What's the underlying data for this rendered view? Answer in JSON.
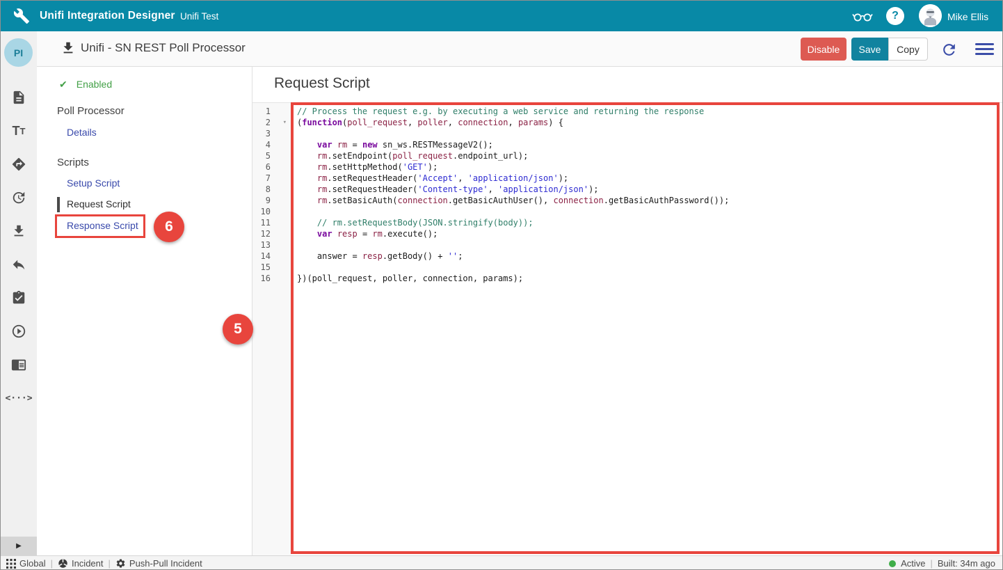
{
  "header": {
    "app_title": "Unifi Integration Designer",
    "workspace": "Unifi Test",
    "user_name": "Mike Ellis"
  },
  "toolbar": {
    "avatar_initials": "PI",
    "title": "Unifi - SN REST Poll Processor",
    "disable_label": "Disable",
    "save_label": "Save",
    "copy_label": "Copy"
  },
  "sidebar": {
    "icons": [
      "document",
      "text-format",
      "directions",
      "history",
      "download",
      "undo",
      "tasks",
      "run",
      "documentation",
      "code"
    ]
  },
  "nav": {
    "enabled_label": "Enabled",
    "enabled_check": "✔",
    "poll_processor_title": "Poll Processor",
    "details_label": "Details",
    "scripts_title": "Scripts",
    "setup_script_label": "Setup Script",
    "request_script_label": "Request Script",
    "response_script_label": "Response Script"
  },
  "annotations": {
    "step_5": "5",
    "step_6": "6"
  },
  "editor": {
    "heading": "Request Script",
    "fold_marker": "▾",
    "fold_line": 2,
    "lines": [
      [
        {
          "c": "c",
          "t": "// Process the request e.g. by executing a web service and returning the response"
        }
      ],
      [
        {
          "c": "p",
          "t": "("
        },
        {
          "c": "k",
          "t": "function"
        },
        {
          "c": "p",
          "t": "("
        },
        {
          "c": "v",
          "t": "poll_request"
        },
        {
          "c": "p",
          "t": ", "
        },
        {
          "c": "v",
          "t": "poller"
        },
        {
          "c": "p",
          "t": ", "
        },
        {
          "c": "v",
          "t": "connection"
        },
        {
          "c": "p",
          "t": ", "
        },
        {
          "c": "v",
          "t": "params"
        },
        {
          "c": "p",
          "t": ") {"
        }
      ],
      [],
      [
        {
          "c": "p",
          "t": "    "
        },
        {
          "c": "k",
          "t": "var"
        },
        {
          "c": "p",
          "t": " "
        },
        {
          "c": "v",
          "t": "rm"
        },
        {
          "c": "p",
          "t": " = "
        },
        {
          "c": "k",
          "t": "new"
        },
        {
          "c": "p",
          "t": " sn_ws.RESTMessageV2();"
        }
      ],
      [
        {
          "c": "p",
          "t": "    "
        },
        {
          "c": "v",
          "t": "rm"
        },
        {
          "c": "p",
          "t": ".setEndpoint("
        },
        {
          "c": "v",
          "t": "poll_request"
        },
        {
          "c": "p",
          "t": ".endpoint_url);"
        }
      ],
      [
        {
          "c": "p",
          "t": "    "
        },
        {
          "c": "v",
          "t": "rm"
        },
        {
          "c": "p",
          "t": ".setHttpMethod("
        },
        {
          "c": "s",
          "t": "'GET'"
        },
        {
          "c": "p",
          "t": ");"
        }
      ],
      [
        {
          "c": "p",
          "t": "    "
        },
        {
          "c": "v",
          "t": "rm"
        },
        {
          "c": "p",
          "t": ".setRequestHeader("
        },
        {
          "c": "s",
          "t": "'Accept'"
        },
        {
          "c": "p",
          "t": ", "
        },
        {
          "c": "s",
          "t": "'application/json'"
        },
        {
          "c": "p",
          "t": ");"
        }
      ],
      [
        {
          "c": "p",
          "t": "    "
        },
        {
          "c": "v",
          "t": "rm"
        },
        {
          "c": "p",
          "t": ".setRequestHeader("
        },
        {
          "c": "s",
          "t": "'Content-type'"
        },
        {
          "c": "p",
          "t": ", "
        },
        {
          "c": "s",
          "t": "'application/json'"
        },
        {
          "c": "p",
          "t": ");"
        }
      ],
      [
        {
          "c": "p",
          "t": "    "
        },
        {
          "c": "v",
          "t": "rm"
        },
        {
          "c": "p",
          "t": ".setBasicAuth("
        },
        {
          "c": "v",
          "t": "connection"
        },
        {
          "c": "p",
          "t": ".getBasicAuthUser(), "
        },
        {
          "c": "v",
          "t": "connection"
        },
        {
          "c": "p",
          "t": ".getBasicAuthPassword());"
        }
      ],
      [],
      [
        {
          "c": "p",
          "t": "    "
        },
        {
          "c": "c",
          "t": "// rm.setRequestBody(JSON.stringify(body));"
        }
      ],
      [
        {
          "c": "p",
          "t": "    "
        },
        {
          "c": "k",
          "t": "var"
        },
        {
          "c": "p",
          "t": " "
        },
        {
          "c": "v",
          "t": "resp"
        },
        {
          "c": "p",
          "t": " = "
        },
        {
          "c": "v",
          "t": "rm"
        },
        {
          "c": "p",
          "t": ".execute();"
        }
      ],
      [],
      [
        {
          "c": "p",
          "t": "    answer = "
        },
        {
          "c": "v",
          "t": "resp"
        },
        {
          "c": "p",
          "t": ".getBody() + "
        },
        {
          "c": "s",
          "t": "''"
        },
        {
          "c": "p",
          "t": ";"
        }
      ],
      [],
      [
        {
          "c": "p",
          "t": "})(poll_request, poller, connection, params);"
        }
      ]
    ]
  },
  "statusbar": {
    "separator": "|",
    "scope_label": "Global",
    "integration_label": "Incident",
    "message_label": "Push-Pull Incident",
    "status_label": "Active",
    "built_label": "Built: 34m ago"
  },
  "colors": {
    "accent_teal": "#0889a6",
    "annotation_red": "#e8453d",
    "link_blue": "#3949ab",
    "enabled_green": "#43a047",
    "disable_button_red": "#dd5a52"
  }
}
